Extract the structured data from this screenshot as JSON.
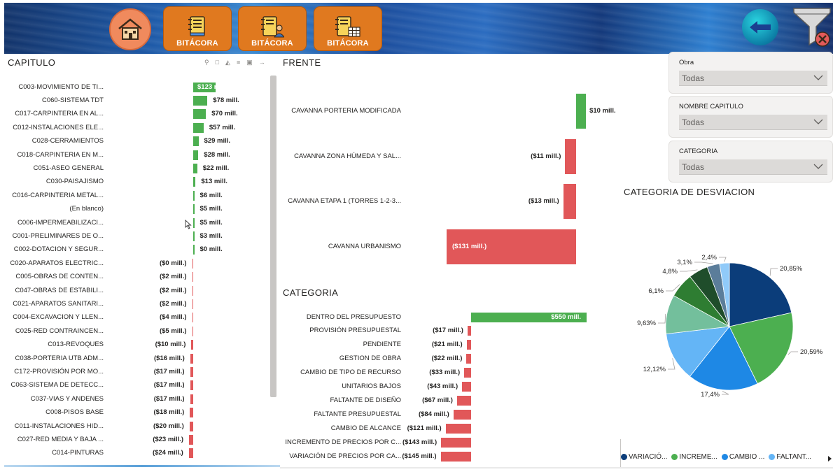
{
  "header": {
    "home_icon": "home-icon",
    "buttons": [
      {
        "label": "BITÁCORA",
        "icon": "notebook-icon"
      },
      {
        "label": "BITÁCORA",
        "icon": "notebook-user-icon"
      },
      {
        "label": "BITÁCORA",
        "icon": "notebook-table-icon"
      }
    ],
    "back_icon": "arrow-left-icon",
    "clear_filter_icon": "clear-filter-icon"
  },
  "colors": {
    "positive": "#4caf50",
    "negative": "#e15759",
    "orange_button": "#e0791f"
  },
  "slicers": [
    {
      "label": "Obra",
      "value": "Todas"
    },
    {
      "label": "NOMBRE CAPITULO",
      "value": "Todas"
    },
    {
      "label": "CATEGORIA",
      "value": "Todas"
    }
  ],
  "legend": {
    "items": [
      {
        "label": "VARIACIÓ...",
        "color": "#0b3d7a"
      },
      {
        "label": "INCREME...",
        "color": "#4caf50"
      },
      {
        "label": "CAMBIO ...",
        "color": "#1e88e5"
      },
      {
        "label": "FALTANT...",
        "color": "#64b5f6"
      }
    ]
  },
  "chart_data": [
    {
      "type": "bar",
      "orientation": "horizontal",
      "title": "CAPITULO",
      "unit": "mill.",
      "categories": [
        "C003-MOVIMIENTO DE TI...",
        "C060-SISTEMA TDT",
        "C017-CARPINTERIA EN AL...",
        "C012-INSTALACIONES ELE...",
        "C028-CERRAMIENTOS",
        "C018-CARPINTERIA EN M...",
        "C051-ASEO GENERAL",
        "C030-PAISAJISMO",
        "C016-CARPINTERIA METAL...",
        "(En blanco)",
        "C006-IMPERMEABILIZACI...",
        "C001-PRELIMINARES DE O...",
        "C002-DOTACION Y SEGUR...",
        "C020-APARATOS ELECTRIC...",
        "C005-OBRAS DE CONTEN...",
        "C047-OBRAS DE ESTABILI...",
        "C021-APARATOS SANITARI...",
        "C004-EXCAVACION Y LLEN...",
        "C025-RED CONTRAINCEN...",
        "C013-REVOQUES",
        "C038-PORTERIA UTB ADM...",
        "C172-PROVISIÓN POR MO...",
        "C063-SISTEMA DE DETECC...",
        "C037-VIAS Y ANDENES",
        "C008-PISOS BASE",
        "C011-INSTALACIONES HID...",
        "C027-RED MEDIA Y BAJA ...",
        "C014-PINTURAS"
      ],
      "values": [
        123,
        78,
        70,
        57,
        29,
        28,
        22,
        13,
        6,
        5,
        5,
        3,
        0,
        -0.3,
        -2,
        -2,
        -2,
        -4,
        -5,
        -10,
        -16,
        -17,
        -17,
        -17,
        -18,
        -20,
        -23,
        -24
      ],
      "labels": [
        "$123 mill.",
        "$78 mill.",
        "$70 mill.",
        "$57 mill.",
        "$29 mill.",
        "$28 mill.",
        "$22 mill.",
        "$13 mill.",
        "$6 mill.",
        "$5 mill.",
        "$5 mill.",
        "$3 mill.",
        "$0 mill.",
        "($0 mill.)",
        "($2 mill.)",
        "($2 mill.)",
        "($2 mill.)",
        "($4 mill.)",
        "($5 mill.)",
        "($10 mill.)",
        "($16 mill.)",
        "($17 mill.)",
        "($17 mill.)",
        "($17 mill.)",
        "($18 mill.)",
        "($20 mill.)",
        "($23 mill.)",
        "($24 mill.)"
      ]
    },
    {
      "type": "bar",
      "orientation": "horizontal",
      "title": "FRENTE",
      "unit": "mill.",
      "categories": [
        "CAVANNA PORTERIA MODIFICADA",
        "CAVANNA ZONA HÚMEDA Y SAL...",
        "CAVANNA ETAPA 1 (TORRES 1-2-3...",
        "CAVANNA URBANISMO"
      ],
      "values": [
        10,
        -11,
        -13,
        -131
      ],
      "labels": [
        "$10 mill.",
        "($11 mill.)",
        "($13 mill.)",
        "($131 mill.)"
      ]
    },
    {
      "type": "bar",
      "orientation": "horizontal",
      "title": "CATEGORIA",
      "unit": "mill.",
      "categories": [
        "DENTRO DEL PRESUPUESTO",
        "PROVISIÓN PRESUPUESTAL",
        "PENDIENTE",
        "GESTION DE OBRA",
        "CAMBIO DE TIPO DE RECURSO",
        "UNITARIOS BAJOS",
        "FALTANTE DE DISEÑO",
        "FALTANTE PRESUPUESTAL",
        "CAMBIO DE ALCANCE",
        "INCREMENTO DE PRECIOS POR C...",
        "VARIACIÓN DE PRECIOS POR CA..."
      ],
      "values": [
        550,
        -17,
        -21,
        -22,
        -33,
        -43,
        -67,
        -84,
        -121,
        -143,
        -145
      ],
      "labels": [
        "$550 mill.",
        "($17 mill.)",
        "($21 mill.)",
        "($22 mill.)",
        "($33 mill.)",
        "($43 mill.)",
        "($67 mill.)",
        "($84 mill.)",
        "($121 mill.)",
        "($143 mill.)",
        "($145 mill.)"
      ]
    },
    {
      "type": "pie",
      "title": "CATEGORIA DE DESVIACION",
      "values": [
        20.85,
        20.59,
        17.4,
        12.12,
        9.63,
        6.1,
        4.8,
        3.1,
        2.4
      ],
      "labels": [
        "20,85%",
        "20,59%",
        "17,4%",
        "12,12%",
        "9,63%",
        "6,1%",
        "4,8%",
        "3,1%",
        "2,4%"
      ],
      "colors": [
        "#0b3d7a",
        "#4caf50",
        "#1e88e5",
        "#64b5f6",
        "#73bf9c",
        "#2e7d32",
        "#1f4d2b",
        "#5b7d9a",
        "#90caf9"
      ]
    }
  ]
}
